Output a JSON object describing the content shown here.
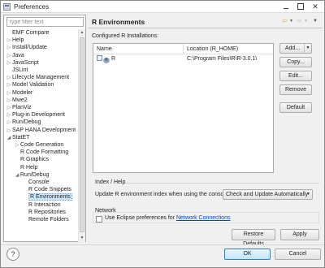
{
  "window": {
    "title": "Preferences",
    "minimize_icon": "minimize-icon",
    "maximize_icon": "maximize-icon",
    "close_glyph": "✕"
  },
  "filter": {
    "placeholder": "type filter text"
  },
  "tree": [
    {
      "label": "EMF Compare",
      "arrow": "",
      "level": 0
    },
    {
      "label": "Help",
      "arrow": "▷",
      "level": 0
    },
    {
      "label": "Install/Update",
      "arrow": "▷",
      "level": 0
    },
    {
      "label": "Java",
      "arrow": "▷",
      "level": 0
    },
    {
      "label": "JavaScript",
      "arrow": "▷",
      "level": 0
    },
    {
      "label": "JSLint",
      "arrow": "",
      "level": 0
    },
    {
      "label": "Lifecycle Management",
      "arrow": "▷",
      "level": 0
    },
    {
      "label": "Model Validation",
      "arrow": "▷",
      "level": 0
    },
    {
      "label": "Modeler",
      "arrow": "▷",
      "level": 0
    },
    {
      "label": "Mwe2",
      "arrow": "▷",
      "level": 0
    },
    {
      "label": "PlanViz",
      "arrow": "▷",
      "level": 0
    },
    {
      "label": "Plug-in Development",
      "arrow": "▷",
      "level": 0
    },
    {
      "label": "Run/Debug",
      "arrow": "▷",
      "level": 0
    },
    {
      "label": "SAP HANA Development",
      "arrow": "▷",
      "level": 0
    },
    {
      "label": "StatET",
      "arrow": "◢",
      "level": 0
    },
    {
      "label": "Code Generation",
      "arrow": "▷",
      "level": 1
    },
    {
      "label": "R Code Formatting",
      "arrow": "",
      "level": 1
    },
    {
      "label": "R Graphics",
      "arrow": "",
      "level": 1
    },
    {
      "label": "R Help",
      "arrow": "",
      "level": 1
    },
    {
      "label": "Run/Debug",
      "arrow": "◢",
      "level": 1
    },
    {
      "label": "Console",
      "arrow": "",
      "level": 2
    },
    {
      "label": "R Code Snippets",
      "arrow": "",
      "level": 2
    },
    {
      "label": "R Environments",
      "arrow": "",
      "level": 2,
      "selected": true
    },
    {
      "label": "R Interaction",
      "arrow": "",
      "level": 2
    },
    {
      "label": "R Repositories",
      "arrow": "",
      "level": 2
    },
    {
      "label": "Remote Folders",
      "arrow": "",
      "level": 2
    }
  ],
  "page": {
    "title": "R Environments",
    "installed_label": "Configured R Installations:",
    "table": {
      "headers": [
        "Name",
        "Location (R_HOME)"
      ],
      "rows": [
        {
          "name": "R",
          "location": "C:\\Program Files\\R\\R-3.0.1\\"
        }
      ]
    },
    "buttons": {
      "add": "Add...",
      "copy": "Copy...",
      "edit": "Edit...",
      "remove": "Remove",
      "default": "Default"
    },
    "index_group": "Index / Help",
    "update_label": "Update R environment index when using the console:",
    "update_value": "Check and Update Automatically",
    "network_group": "Network",
    "network_text": "Use Eclipse preferences for",
    "network_link": "Network Connections",
    "restore_defaults": "Restore Defaults",
    "apply": "Apply"
  },
  "footer": {
    "help": "?",
    "ok": "OK",
    "cancel": "Cancel"
  }
}
